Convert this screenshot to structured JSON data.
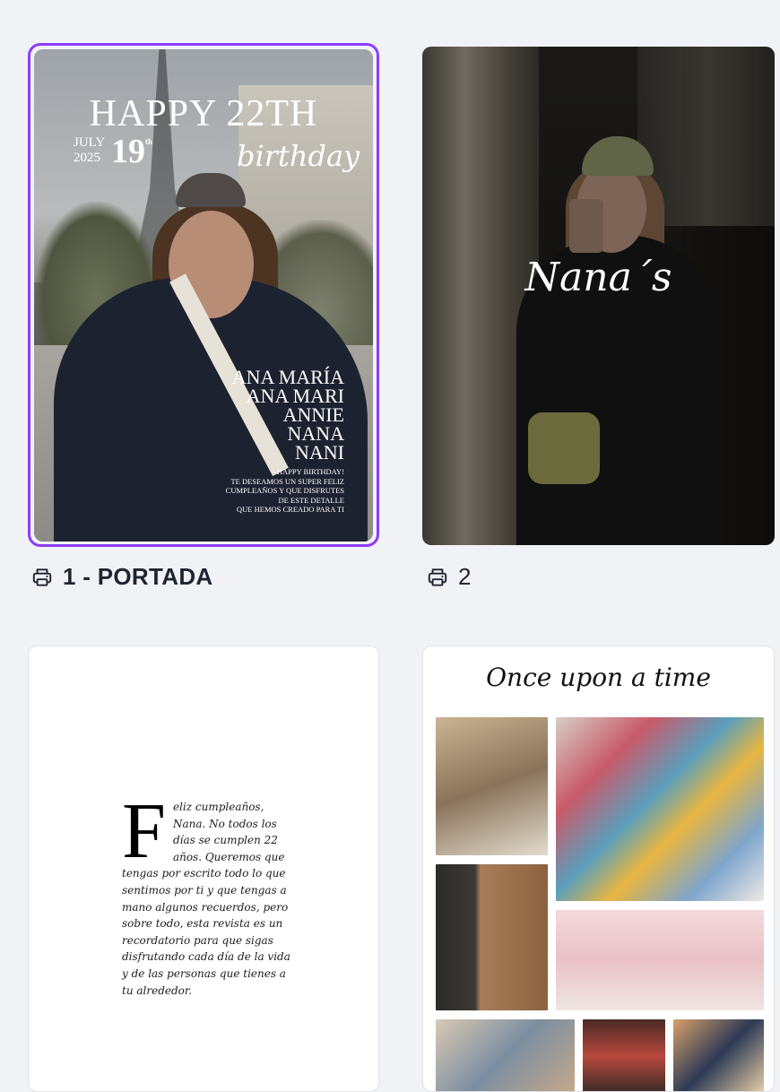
{
  "pages": [
    {
      "label": "1 - PORTADA",
      "selected": true,
      "cover": {
        "headline": "HAPPY 22TH",
        "month": "JULY",
        "year": "2025",
        "day": "19",
        "day_suffix": "th",
        "script_word": "birthday",
        "names": [
          "ANA MARÍA",
          "ANA MARI",
          "ANNIE",
          "NANA",
          "NANI"
        ],
        "message": [
          "HAPPY BIRTHDAY!",
          "TE DESEAMOS UN SUPER FELIZ",
          "CUMPLEAÑOS Y QUE DISFRUTES",
          "DE ESTE DETALLE",
          "QUE HEMOS CREADO PARA TI"
        ]
      }
    },
    {
      "label": "2",
      "selected": false,
      "title": "Nana´s"
    },
    {
      "label": "",
      "dropcap": "F",
      "body": "eliz cumpleaños, Nana. No todos los días se cumplen 22 años. Queremos que tengas por escrito todo lo que sentimos por ti y que tengas a mano algunos recuerdos, pero sobre todo, esta revista es un recordatorio para que sigas disfrutando cada día de la vida y de las personas que tienes a tu alrededor."
    },
    {
      "label": "",
      "title": "Once upon a time"
    }
  ],
  "icons": {
    "print": "printer-icon"
  },
  "colors": {
    "selection": "#8b3dff",
    "background": "#f1f2f6"
  }
}
